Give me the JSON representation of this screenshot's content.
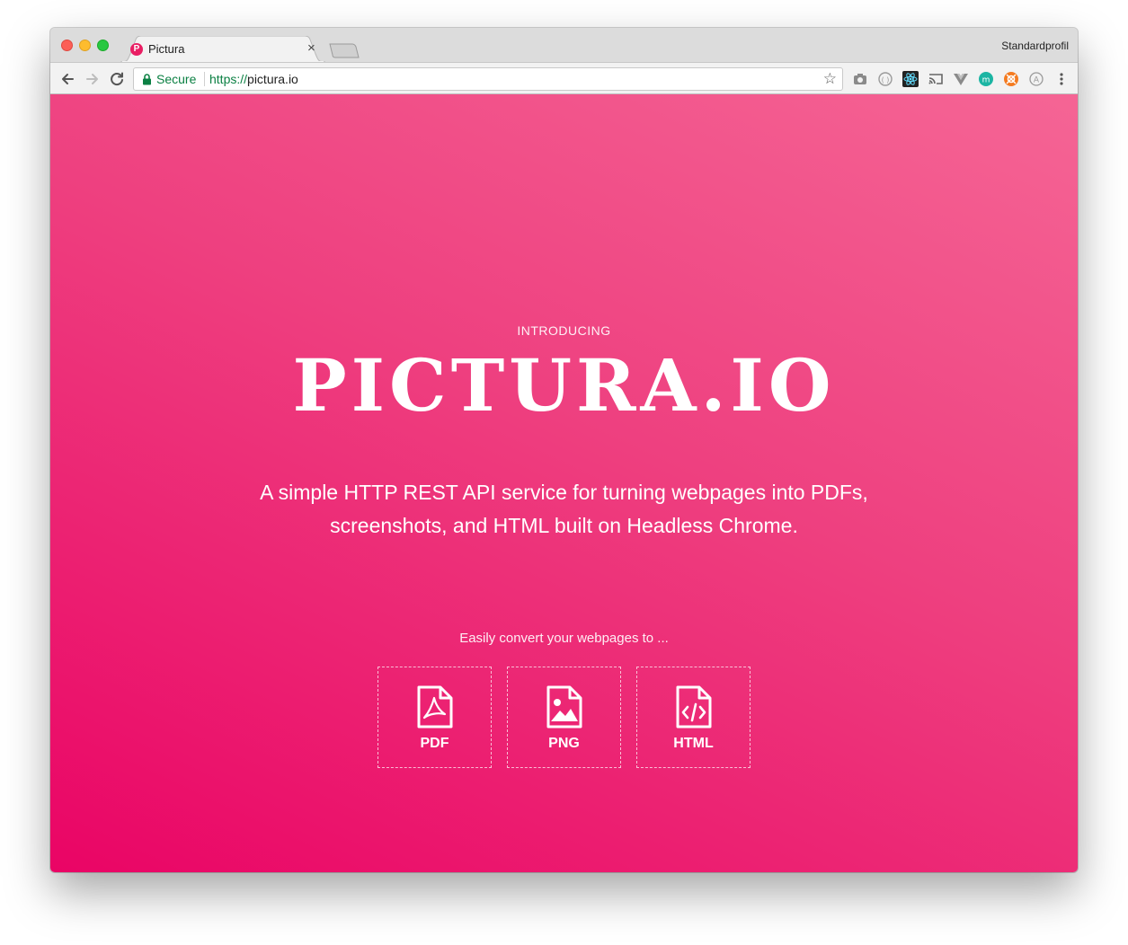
{
  "browser": {
    "tab_title": "Pictura",
    "tab_close": "×",
    "favicon_letter": "P",
    "profile_name": "Standardprofil",
    "secure_label": "Secure",
    "url_scheme": "https://",
    "url_host": "pictura.io",
    "star": "☆",
    "extensions": [
      "camera-icon",
      "circle-dots-icon",
      "react-icon",
      "cast-icon",
      "vue-icon",
      "m-badge-icon",
      "orange-badge-icon",
      "a-circle-icon",
      "kebab-menu-icon"
    ]
  },
  "hero": {
    "intro": "INTRODUCING",
    "title": "PICTURA.IO",
    "tagline": "A simple HTTP REST API service for turning webpages into PDFs, screenshots, and HTML built on Headless Chrome.",
    "convert_label": "Easily convert your webpages to ..."
  },
  "formats": [
    {
      "label": "PDF",
      "icon": "pdf-file-icon"
    },
    {
      "label": "PNG",
      "icon": "image-file-icon"
    },
    {
      "label": "HTML",
      "icon": "code-file-icon"
    }
  ],
  "colors": {
    "gradient_top": "#f56595",
    "gradient_bottom": "#ea0465",
    "secure_green": "#0b8043",
    "favicon": "#e91e63"
  }
}
